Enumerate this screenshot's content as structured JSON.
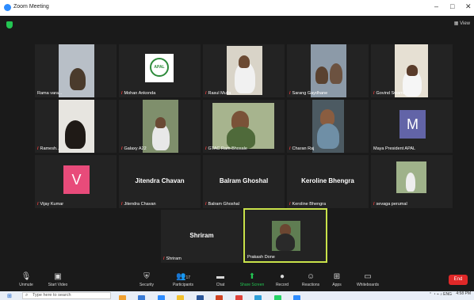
{
  "window": {
    "title": "Zoom Meeting",
    "minimize_glyph": "–",
    "maximize_glyph": "□",
    "close_glyph": "✕"
  },
  "meeting": {
    "view_label": "View"
  },
  "participants": [
    {
      "label": "Rama vara..."
    },
    {
      "label": "Mohan Ankonda",
      "logo_text": "APAL"
    },
    {
      "label": "Rasul Mulla"
    },
    {
      "label": "Sarang Gaydhane"
    },
    {
      "label": "Govind Swami"
    },
    {
      "label": "Ramesh..."
    },
    {
      "label": "Galaxy A22"
    },
    {
      "label": "GTAC Ram Bhosale"
    },
    {
      "label": "Charan Raj"
    },
    {
      "label": "Maya President APAL",
      "avatar_letter": "M",
      "avatar_color": "#6264a7"
    },
    {
      "label": "Vijay Kumar",
      "avatar_letter": "V",
      "avatar_color": "#e84b7a"
    },
    {
      "label": "Jitendra Chavan",
      "center_name": "Jitendra Chavan"
    },
    {
      "label": "Balram Ghoshal",
      "center_name": "Balram Ghoshal"
    },
    {
      "label": "Keroline Bhengra",
      "center_name": "Keroline Bhengra"
    },
    {
      "label": "sevaga perumal"
    },
    {
      "label": "Shriram",
      "center_name": "Shriram"
    },
    {
      "label": "Prakash Done"
    }
  ],
  "toolbar": {
    "unmute": "Unmute",
    "start_video": "Start Video",
    "security": "Security",
    "participants": "Participants",
    "participants_count": "17",
    "chat": "Chat",
    "share_screen": "Share Screen",
    "record": "Record",
    "reactions": "Reactions",
    "apps": "Apps",
    "whiteboards": "Whiteboards",
    "end": "End"
  },
  "taskbar": {
    "search_placeholder": "Type here to search",
    "tray_lang": "ENG",
    "time": "4:58 PM"
  },
  "colors": {
    "accent_green": "#23c552",
    "end_red": "#e02828",
    "active_speaker": "#c9e24a",
    "muted_red": "#ff4040"
  }
}
